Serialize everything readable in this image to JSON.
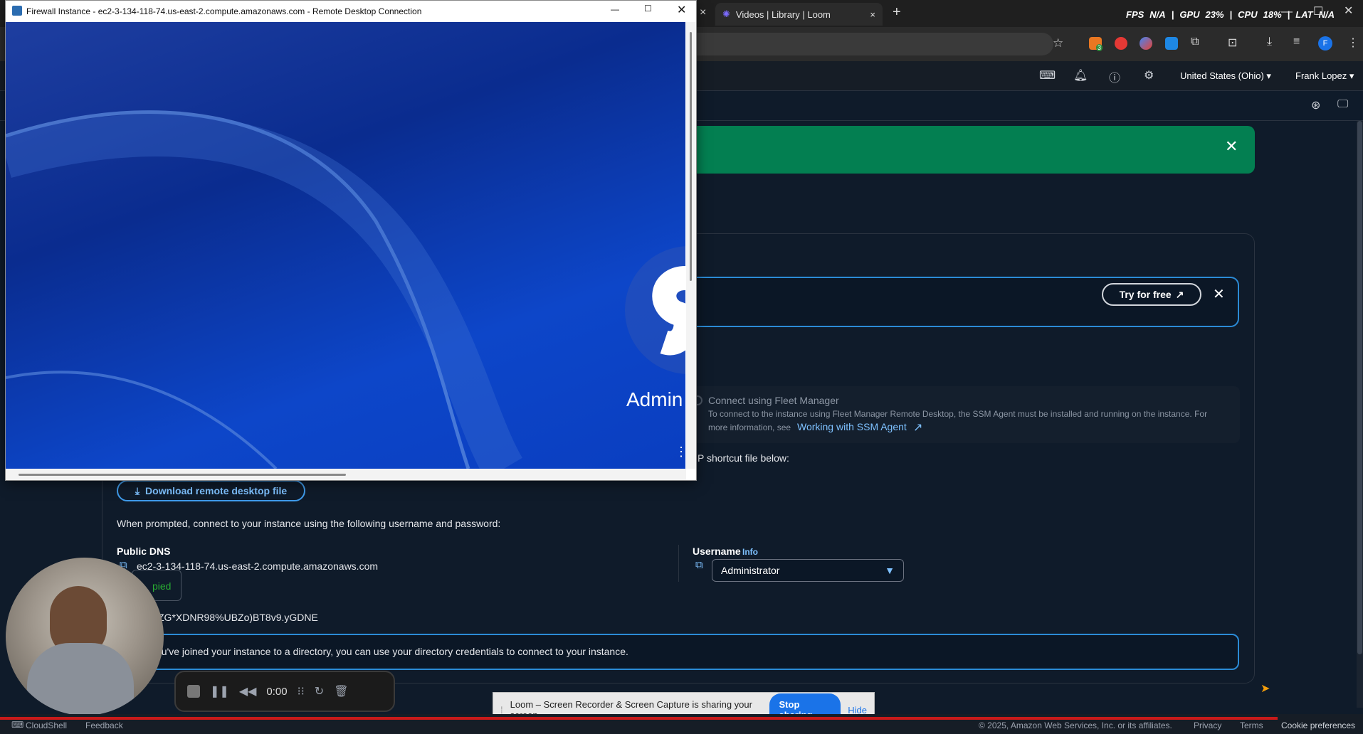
{
  "browser": {
    "active_tab_close": "×",
    "tabs": [
      {
        "title": "Videos | Library | Loom"
      }
    ],
    "new_tab": "+",
    "perf": {
      "fps_label": "FPS",
      "fps_value": "N/A",
      "gpu_label": "GPU",
      "gpu_value": "23%",
      "cpu_label": "CPU",
      "cpu_value": "18%",
      "lat_label": "LAT",
      "lat_value": "N/A"
    },
    "profile_initial": "F",
    "extension_badge": "3"
  },
  "aws_header": {
    "region": "United States (Ohio) ▾",
    "user": "Frank Lopez ▾"
  },
  "page": {
    "promo": {
      "try_label": "Try for free"
    },
    "fleet": {
      "title": "Connect using Fleet Manager",
      "desc": "To connect to the instance using Fleet Manager Remote Desktop, the SSM Agent must be installed and running on the instance. For",
      "desc2": "more information, see",
      "link": "Working with SSM Agent"
    },
    "shortcut_text": "P shortcut file below:",
    "download_label": "Download remote desktop file",
    "prompt_text": "When prompted, connect to your instance using the following username and password:",
    "public_dns_label": "Public DNS",
    "public_dns_value": "ec2-3-134-118-74.us-east-2.compute.amazonaws.com",
    "copied_label": "pied",
    "username_label": "Username",
    "username_info": "Info",
    "username_value": "Administrator",
    "password_partial": "ZG*XDNR98%UBZo)BT8v9.yGDNE",
    "info_text": "ou've joined your instance to a directory, you can use your directory credentials to connect to your instance."
  },
  "rdp": {
    "title": "Firewall Instance - ec2-3-134-118-74.us-east-2.compute.amazonaws.com - Remote Desktop Connection",
    "login_text": "Admin"
  },
  "loom": {
    "timer": "0:00",
    "share_text": "Loom – Screen Recorder & Screen Capture is sharing your screen.",
    "stop_label": "Stop sharing",
    "hide_label": "Hide"
  },
  "footer": {
    "cloudshell": "CloudShell",
    "feedback": "Feedback",
    "copyright": "© 2025, Amazon Web Services, Inc. or its affiliates.",
    "privacy": "Privacy",
    "terms": "Terms",
    "cookies": "Cookie preferences"
  },
  "colors": {
    "flash_green": "#037f51",
    "link_blue": "#3f9bea",
    "loom_blue": "#1a73e8"
  }
}
